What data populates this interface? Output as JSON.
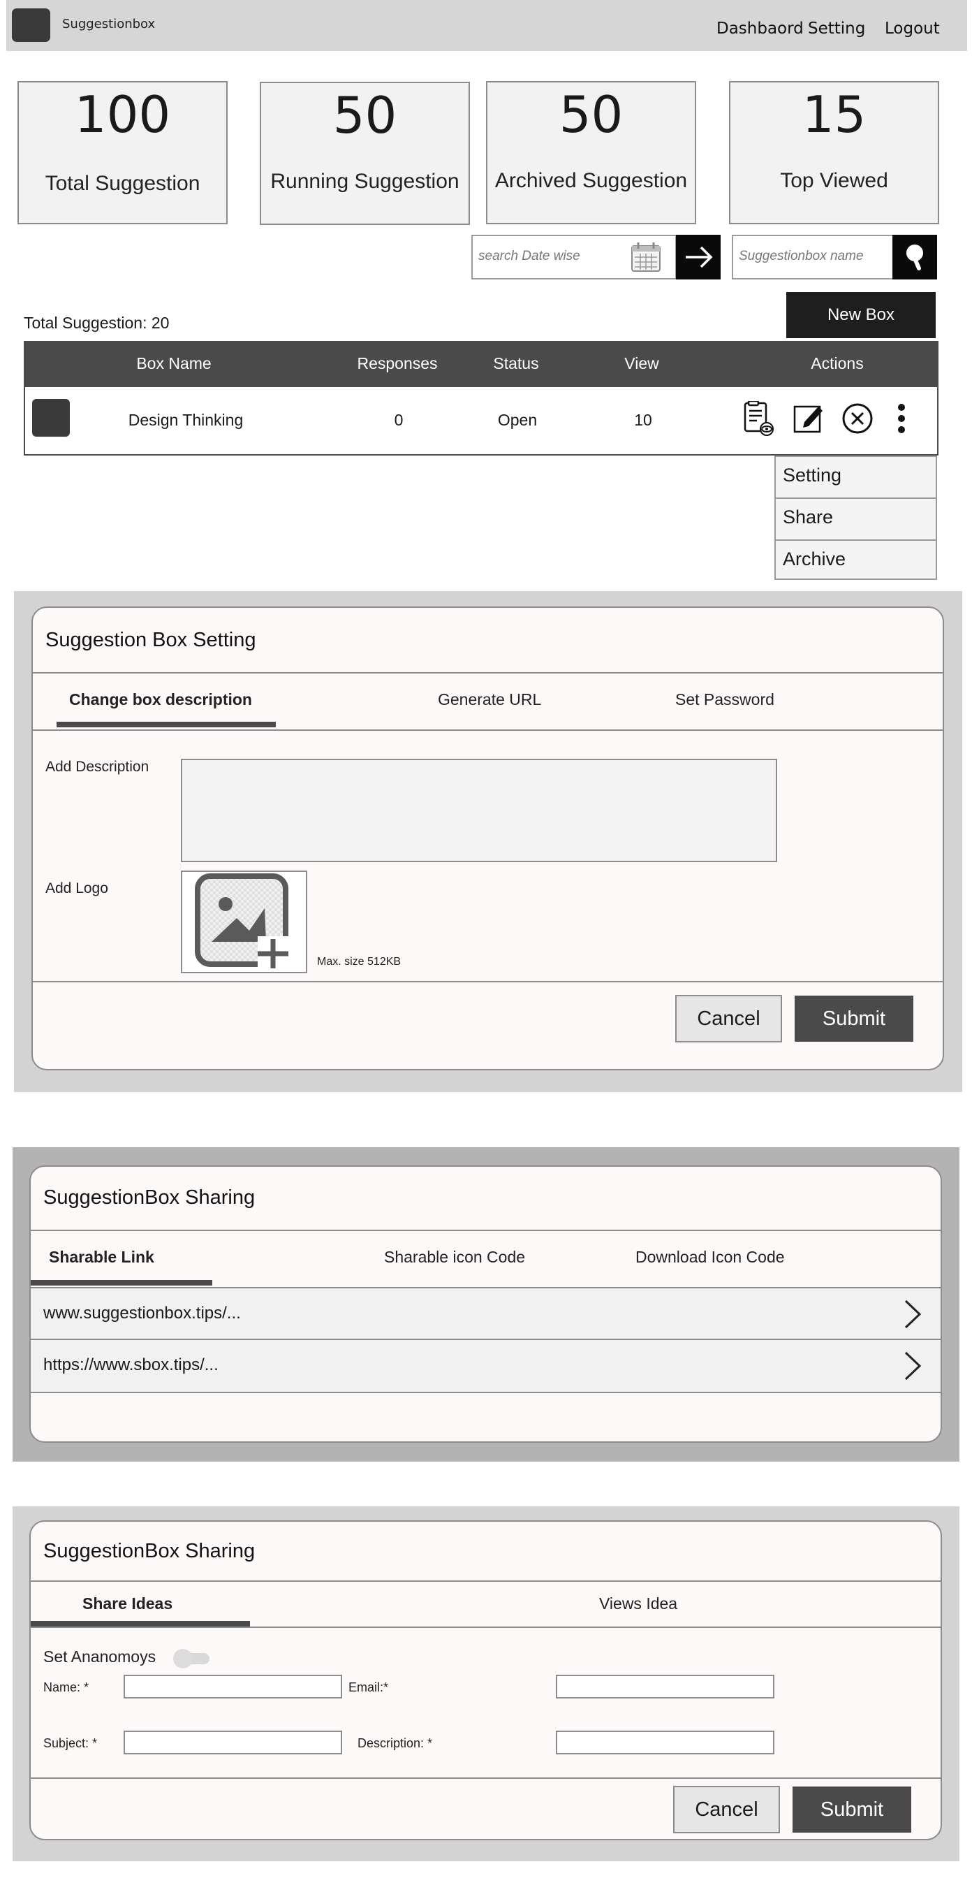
{
  "header": {
    "brand": "Suggestionbox",
    "nav": [
      "Dashbaord",
      "Setting",
      "Logout"
    ]
  },
  "stats": [
    {
      "value": "100",
      "label": "Total Suggestion"
    },
    {
      "value": "50",
      "label": "Running Suggestion"
    },
    {
      "value": "50",
      "label": "Archived Suggestion"
    },
    {
      "value": "15",
      "label": "Top Viewed"
    }
  ],
  "search": {
    "date_placeholder": "search Date wise",
    "name_placeholder": "Suggestionbox name"
  },
  "list": {
    "total_label": "Total Suggestion: 20",
    "new_box_label": "New Box",
    "columns": [
      "Box Name",
      "Responses",
      "Status",
      "View",
      "Actions"
    ],
    "rows": [
      {
        "name": "Design Thinking",
        "responses": "0",
        "status": "Open",
        "view": "10"
      }
    ],
    "menu": [
      "Setting",
      "Share",
      "Archive"
    ]
  },
  "settings_panel": {
    "title": "Suggestion Box Setting",
    "tabs": [
      "Change box description",
      "Generate  URL",
      "Set Password"
    ],
    "description_label": "Add Description",
    "logo_label": "Add Logo",
    "max_size": "Max. size 512KB",
    "cancel": "Cancel",
    "submit": "Submit"
  },
  "sharing_panel": {
    "title": "SuggestionBox Sharing",
    "tabs": [
      "Sharable Link",
      "Sharable icon Code",
      "Download Icon Code"
    ],
    "links": [
      "www.suggestionbox.tips/...",
      "https://www.sbox.tips/..."
    ]
  },
  "ideas_panel": {
    "title": "SuggestionBox Sharing",
    "tabs": [
      "Share Ideas",
      "Views Idea"
    ],
    "anonymous_label": "Set Ananomoys",
    "name_label": "Name: *",
    "email_label": "Email:*",
    "subject_label": "Subject: *",
    "description_label": "Description: *",
    "cancel": "Cancel",
    "submit": "Submit"
  },
  "colors": {
    "dark": "#4a4a4a",
    "panel_bg": "#d3d3d3",
    "panel_fill": "#fdf9f8"
  }
}
